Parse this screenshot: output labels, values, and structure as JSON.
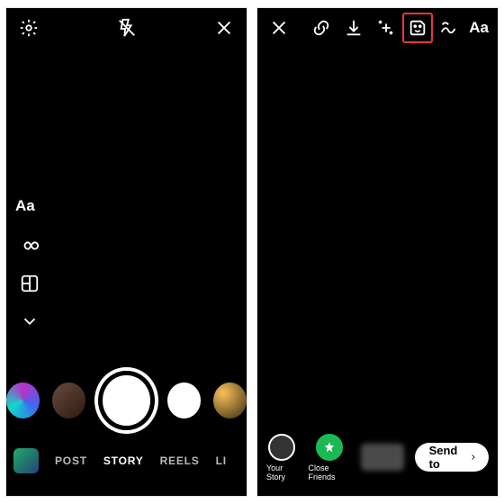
{
  "left_phone": {
    "top": {
      "settings_icon": "gear",
      "flash_icon": "flash-off",
      "close_icon": "close"
    },
    "side_tools": {
      "text_label": "Aa",
      "boomerang_icon": "infinity",
      "layout_icon": "layout",
      "more_icon": "chevron-down"
    },
    "modes": {
      "post": "POST",
      "story": "STORY",
      "reels": "REELS",
      "live": "LI"
    }
  },
  "right_phone": {
    "top": {
      "close_icon": "close",
      "link_icon": "link",
      "download_icon": "download",
      "effects_icon": "sparkle",
      "sticker_icon": "sticker",
      "draw_icon": "scribble",
      "text_label": "Aa"
    },
    "bottom": {
      "your_story_label": "Your Story",
      "close_friends_label": "Close Friends",
      "send_to_label": "Send to"
    }
  }
}
